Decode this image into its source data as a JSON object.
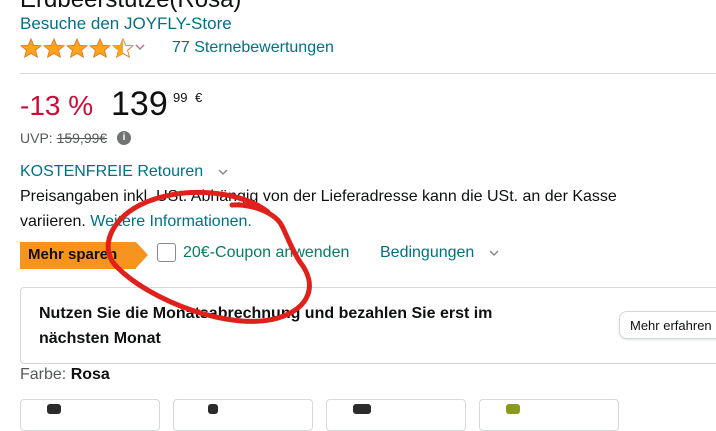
{
  "product": {
    "title_fragment": "Erdbeerstütze(Rosa)",
    "store_link": "Besuche den JOYFLY-Store",
    "rating_value": 4.5,
    "ratings_text": "77 Sternebewertungen"
  },
  "price": {
    "discount": "-13 %",
    "whole": "139",
    "fraction": "99",
    "currency": "€",
    "uvp_label": "UVP:",
    "uvp_value": "159,99€"
  },
  "returns": {
    "label": "KOSTENFREIE Retouren"
  },
  "tax_note": {
    "line1": "Preisangaben inkl. USt. Abhängig von der Lieferadresse kann die USt. an der Kasse",
    "line2_prefix": "variieren.",
    "line2_link": "Weitere Informationen."
  },
  "coupon": {
    "badge": "Mehr sparen",
    "label": "20€-Coupon anwenden",
    "conditions": "Bedingungen"
  },
  "monthly_card": {
    "text": "Nutzen Sie die Monatsabrechnung und bezahlen Sie erst im nächsten Monat",
    "button": "Mehr erfahren"
  },
  "color": {
    "label": "Farbe:",
    "value": "Rosa"
  },
  "colors": {
    "link": "#007185",
    "discount": "#cc0c39",
    "star": "#ffa41c",
    "badge": "#f7941d",
    "coupon": "#067d62",
    "annotation": "#e0201b"
  }
}
